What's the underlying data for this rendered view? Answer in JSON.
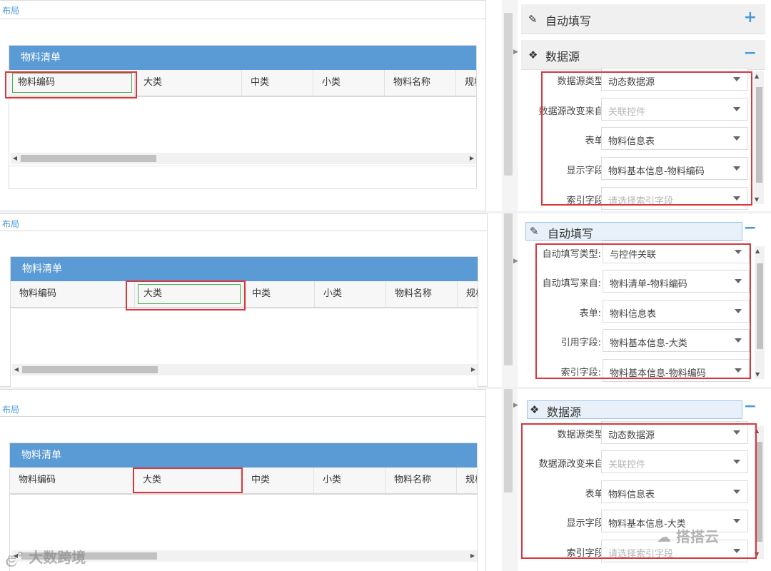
{
  "layout_label": "布局",
  "form_title": "物料清单",
  "columns": [
    "物料编码",
    "大类",
    "中类",
    "小类",
    "物料名称",
    "规格"
  ],
  "sections": {
    "auto_fill": "自动填写",
    "data_source": "数据源",
    "expand_glyph": "+",
    "collapse_glyph": "−"
  },
  "band1_props": [
    {
      "label": "数据源类型:",
      "value": "动态数据源",
      "placeholder": false
    },
    {
      "label": "数据源改变来自:",
      "value": "关联控件",
      "placeholder": true
    },
    {
      "label": "表单:",
      "value": "物料信息表",
      "placeholder": false
    },
    {
      "label": "显示字段:",
      "value": "物料基本信息-物料编码",
      "placeholder": false
    },
    {
      "label": "索引字段:",
      "value": "请选择索引字段",
      "placeholder": true
    }
  ],
  "band2_props": [
    {
      "label": "自动填写类型:",
      "value": "与控件关联",
      "placeholder": false
    },
    {
      "label": "自动填写来自:",
      "value": "物料清单-物料编码",
      "placeholder": false
    },
    {
      "label": "表单:",
      "value": "物料信息表",
      "placeholder": false
    },
    {
      "label": "引用字段:",
      "value": "物料基本信息-大类",
      "placeholder": false
    },
    {
      "label": "索引字段:",
      "value": "物料基本信息-物料编码",
      "placeholder": false
    }
  ],
  "band3_props": [
    {
      "label": "数据源类型:",
      "value": "动态数据源",
      "placeholder": false
    },
    {
      "label": "数据源改变来自:",
      "value": "关联控件",
      "placeholder": true
    },
    {
      "label": "表单:",
      "value": "物料信息表",
      "placeholder": false
    },
    {
      "label": "显示字段:",
      "value": "物料基本信息-大类",
      "placeholder": false
    },
    {
      "label": "索引字段:",
      "value": "请选择索引字段",
      "placeholder": true
    }
  ],
  "watermarks": {
    "left": "大数跨境",
    "right": "搭搭云"
  },
  "colors": {
    "header_blue": "#5b9bd5",
    "highlight_red": "#d9363e",
    "select_green": "#4caf50",
    "accent_blue": "#4a9ad8"
  }
}
